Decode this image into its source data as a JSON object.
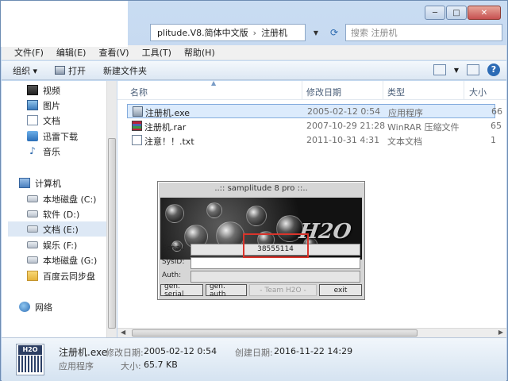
{
  "window": {
    "caption_minimize": "─",
    "caption_maximize": "□",
    "caption_close": "✕"
  },
  "address": {
    "crumb1": "plitude.V8.简体中文版",
    "separator": "›",
    "crumb2": "注册机",
    "dropdown": "▼",
    "refresh": "⟳",
    "search_placeholder": "搜索 注册机"
  },
  "menu": [
    "文件(F)",
    "编辑(E)",
    "查看(V)",
    "工具(T)",
    "帮助(H)"
  ],
  "toolbar": {
    "organize": "组织 ▾",
    "open": "打开",
    "new_folder": "新建文件夹",
    "view_dropdown": "▼",
    "help": "?"
  },
  "sidebar": {
    "items": [
      {
        "label": "视频",
        "icon": "video-icon"
      },
      {
        "label": "图片",
        "icon": "pictures-icon"
      },
      {
        "label": "文档",
        "icon": "documents-icon"
      },
      {
        "label": "迅雷下载",
        "icon": "download-icon"
      },
      {
        "label": "音乐",
        "icon": "music-icon"
      },
      {
        "label": "计算机",
        "icon": "computer-icon"
      },
      {
        "label": "本地磁盘 (C:)",
        "icon": "drive-icon"
      },
      {
        "label": "软件 (D:)",
        "icon": "drive-icon"
      },
      {
        "label": "文档 (E:)",
        "icon": "drive-icon"
      },
      {
        "label": "娱乐 (F:)",
        "icon": "drive-icon"
      },
      {
        "label": "本地磁盘 (G:)",
        "icon": "drive-icon"
      },
      {
        "label": "百度云同步盘",
        "icon": "folder-icon"
      },
      {
        "label": "网络",
        "icon": "network-icon"
      }
    ]
  },
  "columns": {
    "name": "名称",
    "modified": "修改日期",
    "type": "类型",
    "size": "大小"
  },
  "files": [
    {
      "name": "注册机.exe",
      "modified": "2005-02-12 0:54",
      "type": "应用程序",
      "size": "66"
    },
    {
      "name": "注册机.rar",
      "modified": "2007-10-29 21:28",
      "type": "WinRAR 压缩文件",
      "size": "65"
    },
    {
      "name": "注意！！.txt",
      "modified": "2011-10-31 4:31",
      "type": "文本文档",
      "size": "1"
    }
  ],
  "keygen": {
    "title": "..:: samplitude 8 pro ::..",
    "logo": "H2O",
    "serial_label": "Serial:",
    "serial_value": "38555114",
    "sysid_label": "SysID:",
    "sysid_value": "",
    "auth_label": "Auth:",
    "auth_value": "",
    "btn_gen_serial": "gen. serial",
    "btn_gen_auth": "gen. auth",
    "team": "- Team H2O -",
    "btn_exit": "exit"
  },
  "details": {
    "icon_label": "H2O",
    "filename": "注册机.exe",
    "modified_label": "修改日期:",
    "modified_value": "2005-02-12 0:54",
    "created_label": "创建日期:",
    "created_value": "2016-11-22 14:29",
    "type": "应用程序",
    "size_label": "大小:",
    "size_value": "65.7 KB"
  },
  "colors": {
    "highlight": "#d9342b",
    "selection": "#dcebfc",
    "frame": "#c9dcf2"
  }
}
